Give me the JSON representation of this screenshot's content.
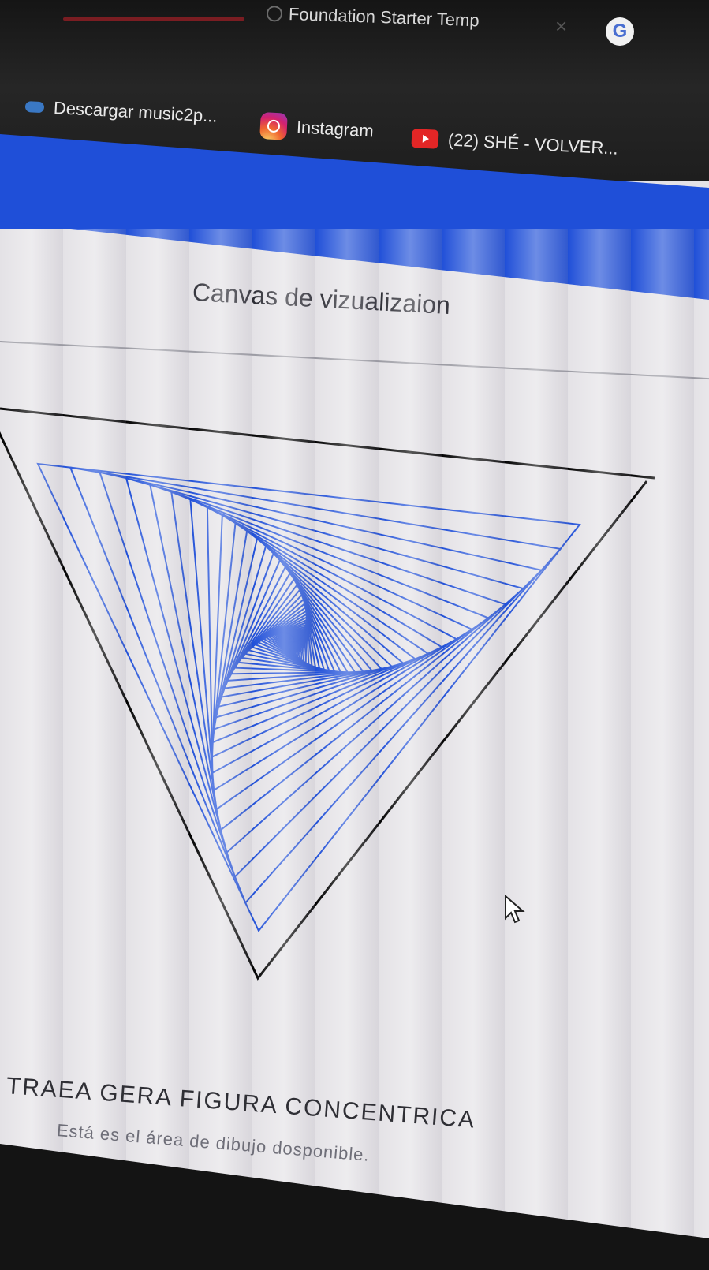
{
  "browser": {
    "tab_title": "Foundation Starter Temp",
    "tab_close": "×",
    "profile_icon_letter": "G",
    "bookmarks": [
      {
        "label": "Descargar music2p...",
        "icon": "cloud-icon"
      },
      {
        "label": "Instagram",
        "icon": "instagram-icon"
      },
      {
        "label": "(22) SHÉ - VOLVER...",
        "icon": "youtube-icon"
      }
    ]
  },
  "page": {
    "title": "Canvas de vizualizaion",
    "caption_heading": "TRAEA GERA FIGURA CONCENTRICA",
    "caption_sub": "Está es el área de dibujo dosponible."
  },
  "drawing": {
    "stroke_color": "#1f4fd8",
    "outline_color": "#000000",
    "line_count": 60,
    "twist_step": 0.06
  },
  "colors": {
    "header_blue": "#1f4fd8",
    "chrome_dark": "#1e1e1e"
  }
}
